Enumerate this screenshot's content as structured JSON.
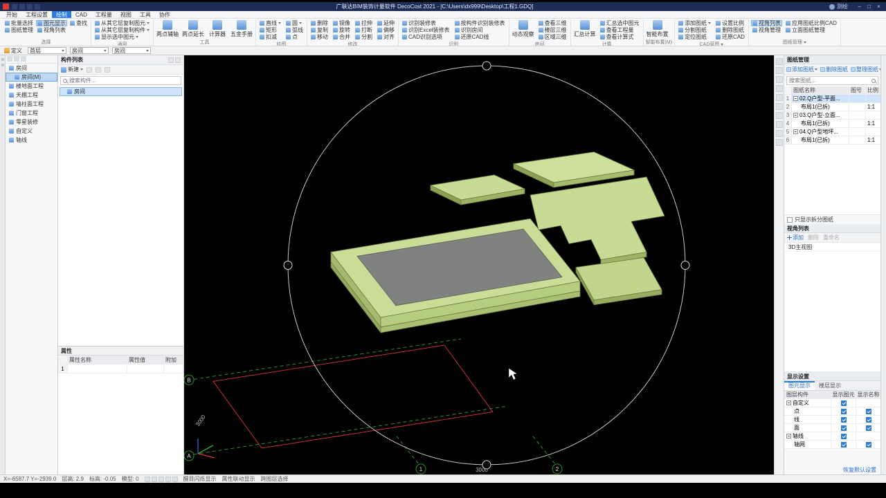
{
  "window": {
    "title": "广联达BIM装饰计量软件 DecoCost 2021 - [C:\\Users\\dx999\\Desktop\\工程1.GDQ]",
    "user": "测绘",
    "controls": {
      "minimize": "–",
      "maximize": "□",
      "close": "×"
    }
  },
  "ribbon": {
    "tabs": [
      "开始",
      "工程设置",
      "绘制",
      "CAD",
      "工程量",
      "视图",
      "工具",
      "协作"
    ],
    "active_tab": "绘制",
    "groups": [
      {
        "name": "选择",
        "buttons": [
          {
            "label": "批量选择"
          },
          {
            "label": "图元显示",
            "active": true
          },
          {
            "label": "查找"
          },
          {
            "label": "图纸管理"
          },
          {
            "label": "视角列表"
          }
        ]
      },
      {
        "name": "通用",
        "buttons": [
          {
            "label": "从其它层复制图元"
          },
          {
            "label": "从其它层复制构件"
          },
          {
            "label": "显示选中图元"
          }
        ]
      },
      {
        "name": "工具",
        "buttons": [
          {
            "label": "两点辅轴"
          },
          {
            "label": "两点延长"
          },
          {
            "label": "计算器"
          },
          {
            "label": "五金手册"
          }
        ]
      },
      {
        "name": "绘图",
        "buttons": [
          {
            "label": "直线"
          },
          {
            "label": "矩形"
          },
          {
            "label": "扣减"
          },
          {
            "label": "圆"
          },
          {
            "label": "弧线"
          },
          {
            "label": "点"
          }
        ]
      },
      {
        "name": "修改",
        "buttons": [
          {
            "label": "删除"
          },
          {
            "label": "复制"
          },
          {
            "label": "移动"
          },
          {
            "label": "镜像"
          },
          {
            "label": "旋转"
          },
          {
            "label": "合并"
          },
          {
            "label": "拉伸"
          },
          {
            "label": "打断"
          },
          {
            "label": "分割"
          },
          {
            "label": "延伸"
          },
          {
            "label": "偏移"
          },
          {
            "label": "对齐"
          }
        ]
      },
      {
        "name": "识别",
        "buttons": [
          {
            "label": "识别装修表"
          },
          {
            "label": "识别Excel装修表"
          },
          {
            "label": "CAD识别选项"
          },
          {
            "label": "按构件识别装修表"
          },
          {
            "label": "识别房间"
          },
          {
            "label": "还原CAD线"
          }
        ]
      },
      {
        "name": "房间",
        "big": "动态观察",
        "buttons": [
          {
            "label": "查看三维"
          },
          {
            "label": "楼层三维"
          },
          {
            "label": "区域三维"
          }
        ]
      },
      {
        "name": "计算",
        "big": "汇总计算",
        "buttons": [
          {
            "label": "汇总选中图元"
          },
          {
            "label": "查看工程量"
          },
          {
            "label": "查看计算式"
          }
        ]
      },
      {
        "name": "智能布置(M)",
        "big": "智能布置",
        "buttons": []
      },
      {
        "name": "CAD草图",
        "buttons": [
          {
            "label": "添加图纸"
          },
          {
            "label": "分割图纸"
          },
          {
            "label": "定位图纸"
          },
          {
            "label": "设置比例"
          },
          {
            "label": "删除图纸"
          },
          {
            "label": "还原CAD"
          }
        ]
      },
      {
        "name": "图纸管理",
        "buttons": [
          {
            "label": "视角列表",
            "active": true
          },
          {
            "label": "视角管理"
          },
          {
            "label": "应用图纸比例CAD"
          },
          {
            "label": "立面图纸管理"
          }
        ]
      }
    ]
  },
  "toolbar": {
    "define_label": "定义",
    "combos": [
      "首层",
      "房间",
      "房间"
    ]
  },
  "nav_tree": {
    "items": [
      {
        "label": "房间"
      },
      {
        "label": "房间(M)",
        "selected": true
      },
      {
        "label": "楼地面工程"
      },
      {
        "label": "天棚工程"
      },
      {
        "label": "墙柱面工程"
      },
      {
        "label": "门窗工程"
      },
      {
        "label": "零星装修"
      },
      {
        "label": "自定义"
      },
      {
        "label": "轴线"
      }
    ]
  },
  "component_panel": {
    "title": "构件列表",
    "new_label": "新建",
    "search_placeholder": "搜索构件...",
    "items": [
      {
        "label": "房间",
        "selected": true
      }
    ]
  },
  "properties_panel": {
    "title": "属性",
    "columns": [
      "属性名称",
      "属性值",
      "附加"
    ],
    "rows": [
      {
        "num": "1",
        "name": "",
        "value": "",
        "extra": ""
      }
    ]
  },
  "viewport": {
    "axis_b": "B",
    "axis_a": "A",
    "axis_1": "1",
    "axis_2": "2",
    "dim_left": "3000",
    "dim_bottom": "3000"
  },
  "sheet_panel": {
    "title": "图纸管理",
    "buttons": [
      "添加图纸",
      "删除图纸",
      "整理图纸"
    ],
    "search_placeholder": "搜索图纸...",
    "columns": [
      "图纸名称",
      "图号",
      "比例"
    ],
    "rows": [
      {
        "num": "1",
        "name": "02.Q户型-平面...",
        "no": "",
        "scale": "",
        "parent": true
      },
      {
        "num": "2",
        "name": "布局1(已拆)",
        "no": "",
        "scale": "1:1"
      },
      {
        "num": "3",
        "name": "03.Q户型-立面...",
        "no": "",
        "scale": "",
        "parent": true
      },
      {
        "num": "4",
        "name": "布局1(已拆)",
        "no": "",
        "scale": "1:1"
      },
      {
        "num": "5",
        "name": "04.Q户型地坪...",
        "no": "",
        "scale": "",
        "parent": true
      },
      {
        "num": "6",
        "name": "布局1(已拆)",
        "no": "",
        "scale": "1:1"
      }
    ],
    "filter_checkbox": "只显示拆分图纸"
  },
  "view_panel": {
    "title": "视角列表",
    "add_label": "添加",
    "disabled_buttons": [
      "删除",
      "重命名"
    ],
    "items": [
      "3D主视图"
    ]
  },
  "display_panel": {
    "title": "显示设置",
    "tabs": [
      "图元显示",
      "楼层显示"
    ],
    "active_tab": "图元显示",
    "columns": [
      "图层构件",
      "显示图元",
      "显示名称"
    ],
    "rows": [
      {
        "label": "自定义",
        "parent": true,
        "show_element": true,
        "show_name": false
      },
      {
        "label": "点",
        "show_element": true,
        "show_name": true
      },
      {
        "label": "线",
        "show_element": true,
        "show_name": true
      },
      {
        "label": "面",
        "show_element": true,
        "show_name": true
      },
      {
        "label": "轴线",
        "parent": true,
        "show_element": true,
        "show_name": false
      },
      {
        "label": "轴网",
        "show_element": true,
        "show_name": true
      }
    ],
    "reset_label": "恢复默认设置"
  },
  "statusbar": {
    "coords": "X=-6587.7 Y=-2939.0",
    "floor_height": "层高: 2.9",
    "elevation": "标高: -0.05",
    "model": "模型: 0",
    "toggles": [
      "醒目闪烁显示",
      "属性联动显示",
      "跨图层选择"
    ]
  },
  "colors": {
    "accent": "#2a7ae0",
    "titlebar_bg": "#1d2b55",
    "viewport_bg": "#000000",
    "model_green": "#c9dd97",
    "model_gray": "#7f827f",
    "grid_red": "#c23232",
    "grid_green": "#2f8f2f",
    "highlight": "#cfe4fa"
  }
}
